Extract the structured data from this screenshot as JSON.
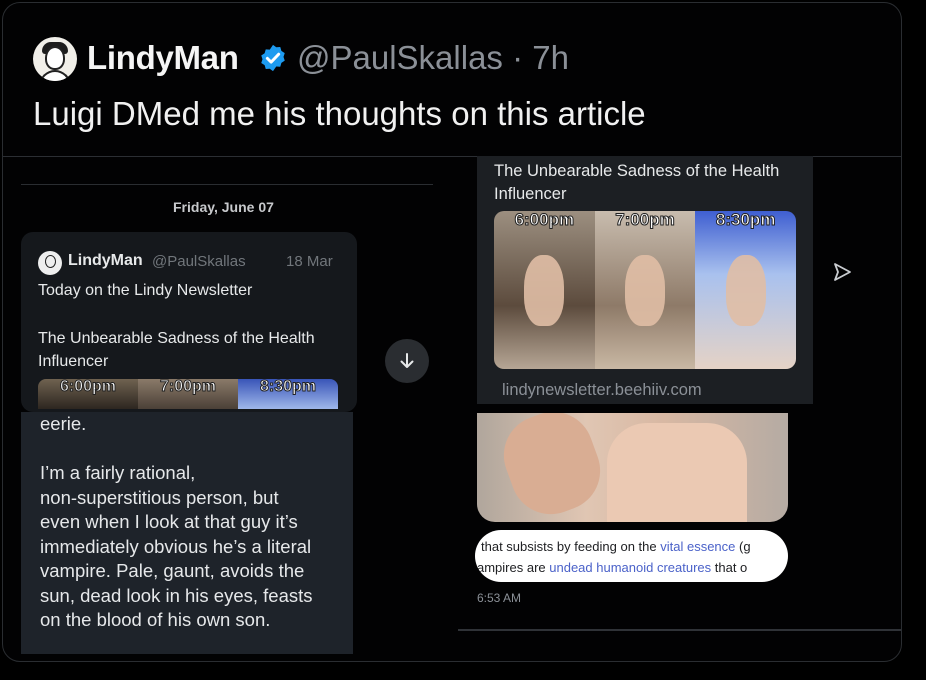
{
  "post": {
    "display_name": "LindyMan",
    "handle_time": "@PaulSkallas · 7h",
    "text": "Luigi DMed me his thoughts on this article"
  },
  "left_dm": {
    "date": "Friday, June 07",
    "shared": {
      "name": "LindyMan",
      "handle": "@PaulSkallas",
      "time": "18 Mar",
      "body": "Today on the Lindy Newsletter",
      "title": "The Unbearable Sadness of the Health Influencer",
      "labels": [
        "6:00pm",
        "7:00pm",
        "8:30pm"
      ]
    },
    "message": "eerie.\n\nI’m a fairly rational,\nnon-superstitious person, but\neven when I look at that guy it’s\nimmediately obvious he’s a literal\nvampire. Pale, gaunt, avoids the\nsun, dead look in his eyes, feasts\non the blood of his own son."
  },
  "right_dm": {
    "title": "The Unbearable Sadness of the Health Influencer",
    "labels": [
      "6:00pm",
      "7:00pm",
      "8:30pm"
    ],
    "link": "lindynewsletter.beehiiv.com",
    "snippet_line1_pre": "that subsists by feeding on the ",
    "snippet_line1_link": "vital essence",
    "snippet_line1_post": " (g",
    "snippet_line2_pre": "ampires are ",
    "snippet_line2_link": "undead humanoid creatures",
    "snippet_line2_post": " that o",
    "time": "6:53 AM"
  },
  "icons": {
    "verified": "verified-badge-icon",
    "down": "arrow-down-icon",
    "send": "send-icon"
  },
  "colors": {
    "verified_blue": "#1d9bf0",
    "link_blue": "#4b62c9"
  }
}
